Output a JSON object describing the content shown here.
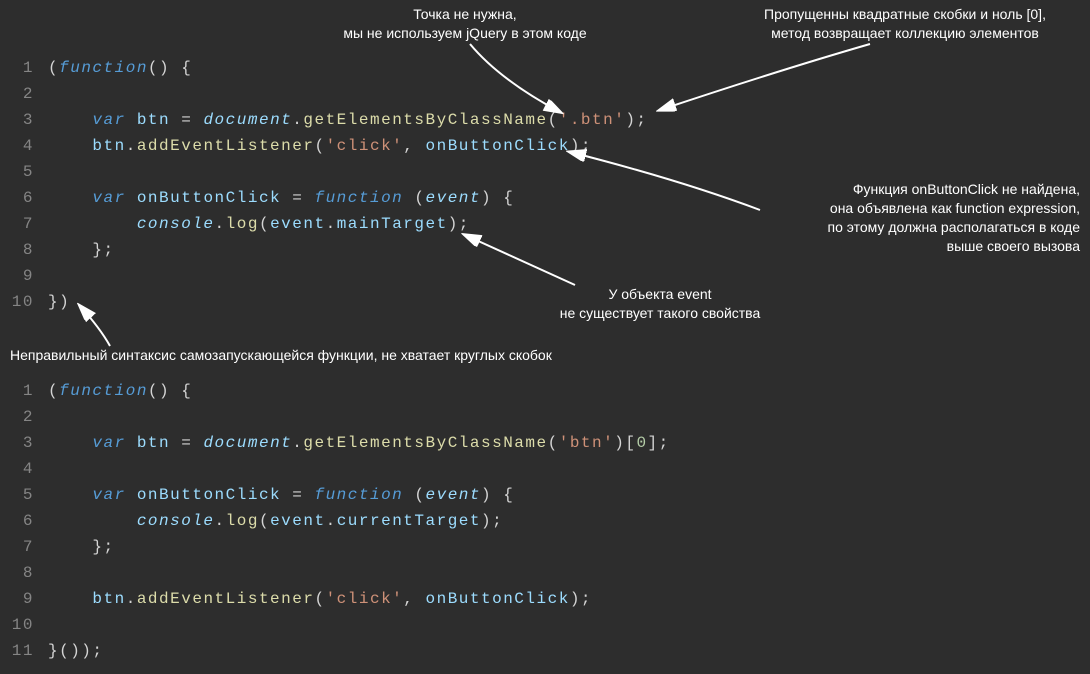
{
  "annotations": {
    "a1": "Точка не нужна,\nмы не используем jQuery в этом коде",
    "a2": "Пропущенны квадратные скобки и ноль [0],\nметод возвращает коллекцию элементов",
    "a3": "Функция onButtonClick не найдена,\nона объявлена как function expression,\nпо этому должна располагаться в коде\nвыше своего вызова",
    "a4": "У объекта event\nне существует такого свойства",
    "a5": "Неправильный синтаксис самозапускающейся функции, не хватает круглых скобок"
  },
  "block1": {
    "lines": [
      [
        {
          "t": "(",
          "c": "p"
        },
        {
          "t": "function",
          "c": "fn"
        },
        {
          "t": "() {",
          "c": "p"
        }
      ],
      [],
      [
        {
          "t": "    ",
          "c": "p"
        },
        {
          "t": "var",
          "c": "kw"
        },
        {
          "t": " ",
          "c": "p"
        },
        {
          "t": "btn",
          "c": "vn"
        },
        {
          "t": " = ",
          "c": "p"
        },
        {
          "t": "document",
          "c": "ob"
        },
        {
          "t": ".",
          "c": "p"
        },
        {
          "t": "getElementsByClassName",
          "c": "mth"
        },
        {
          "t": "(",
          "c": "p"
        },
        {
          "t": "'.btn'",
          "c": "str"
        },
        {
          "t": ");",
          "c": "p"
        }
      ],
      [
        {
          "t": "    ",
          "c": "p"
        },
        {
          "t": "btn",
          "c": "vn"
        },
        {
          "t": ".",
          "c": "p"
        },
        {
          "t": "addEventListener",
          "c": "mth"
        },
        {
          "t": "(",
          "c": "p"
        },
        {
          "t": "'click'",
          "c": "str"
        },
        {
          "t": ", ",
          "c": "p"
        },
        {
          "t": "onButtonClick",
          "c": "vn"
        },
        {
          "t": ");",
          "c": "p"
        }
      ],
      [],
      [
        {
          "t": "    ",
          "c": "p"
        },
        {
          "t": "var",
          "c": "kw"
        },
        {
          "t": " ",
          "c": "p"
        },
        {
          "t": "onButtonClick",
          "c": "vn"
        },
        {
          "t": " = ",
          "c": "p"
        },
        {
          "t": "function",
          "c": "fn"
        },
        {
          "t": " (",
          "c": "p"
        },
        {
          "t": "event",
          "c": "ob"
        },
        {
          "t": ") {",
          "c": "p"
        }
      ],
      [
        {
          "t": "        ",
          "c": "p"
        },
        {
          "t": "console",
          "c": "ob"
        },
        {
          "t": ".",
          "c": "p"
        },
        {
          "t": "log",
          "c": "mth"
        },
        {
          "t": "(",
          "c": "p"
        },
        {
          "t": "event",
          "c": "vn"
        },
        {
          "t": ".",
          "c": "p"
        },
        {
          "t": "mainTarget",
          "c": "vn"
        },
        {
          "t": ");",
          "c": "p"
        }
      ],
      [
        {
          "t": "    };",
          "c": "p"
        }
      ],
      [],
      [
        {
          "t": "})",
          "c": "p"
        }
      ]
    ]
  },
  "block2": {
    "lines": [
      [
        {
          "t": "(",
          "c": "p"
        },
        {
          "t": "function",
          "c": "fn"
        },
        {
          "t": "() {",
          "c": "p"
        }
      ],
      [],
      [
        {
          "t": "    ",
          "c": "p"
        },
        {
          "t": "var",
          "c": "kw"
        },
        {
          "t": " ",
          "c": "p"
        },
        {
          "t": "btn",
          "c": "vn"
        },
        {
          "t": " = ",
          "c": "p"
        },
        {
          "t": "document",
          "c": "ob"
        },
        {
          "t": ".",
          "c": "p"
        },
        {
          "t": "getElementsByClassName",
          "c": "mth"
        },
        {
          "t": "(",
          "c": "p"
        },
        {
          "t": "'btn'",
          "c": "str"
        },
        {
          "t": ")[",
          "c": "p"
        },
        {
          "t": "0",
          "c": "num"
        },
        {
          "t": "];",
          "c": "p"
        }
      ],
      [],
      [
        {
          "t": "    ",
          "c": "p"
        },
        {
          "t": "var",
          "c": "kw"
        },
        {
          "t": " ",
          "c": "p"
        },
        {
          "t": "onButtonClick",
          "c": "vn"
        },
        {
          "t": " = ",
          "c": "p"
        },
        {
          "t": "function",
          "c": "fn"
        },
        {
          "t": " (",
          "c": "p"
        },
        {
          "t": "event",
          "c": "ob"
        },
        {
          "t": ") {",
          "c": "p"
        }
      ],
      [
        {
          "t": "        ",
          "c": "p"
        },
        {
          "t": "console",
          "c": "ob"
        },
        {
          "t": ".",
          "c": "p"
        },
        {
          "t": "log",
          "c": "mth"
        },
        {
          "t": "(",
          "c": "p"
        },
        {
          "t": "event",
          "c": "vn"
        },
        {
          "t": ".",
          "c": "p"
        },
        {
          "t": "currentTarget",
          "c": "vn"
        },
        {
          "t": ");",
          "c": "p"
        }
      ],
      [
        {
          "t": "    };",
          "c": "p"
        }
      ],
      [],
      [
        {
          "t": "    ",
          "c": "p"
        },
        {
          "t": "btn",
          "c": "vn"
        },
        {
          "t": ".",
          "c": "p"
        },
        {
          "t": "addEventListener",
          "c": "mth"
        },
        {
          "t": "(",
          "c": "p"
        },
        {
          "t": "'click'",
          "c": "str"
        },
        {
          "t": ", ",
          "c": "p"
        },
        {
          "t": "onButtonClick",
          "c": "vn"
        },
        {
          "t": ");",
          "c": "p"
        }
      ],
      [],
      [
        {
          "t": "}());",
          "c": "p"
        }
      ]
    ]
  }
}
